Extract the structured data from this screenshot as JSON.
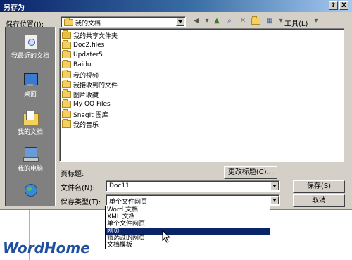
{
  "window": {
    "title": "另存为",
    "help_btn": "?",
    "close_btn": "X"
  },
  "save_in": {
    "label": "保存位置(I):",
    "value": "我的文档"
  },
  "toolbar": {
    "tools_label": "工具(L)"
  },
  "places": [
    {
      "label": "我最近的文档",
      "icon": "recent-docs-icon"
    },
    {
      "label": "桌面",
      "icon": "desktop-icon"
    },
    {
      "label": "我的文档",
      "icon": "my-documents-icon"
    },
    {
      "label": "我的电脑",
      "icon": "my-computer-icon"
    },
    {
      "label": "",
      "icon": "network-icon"
    }
  ],
  "files": [
    {
      "name": "我的共享文件夹",
      "icon": "shared-folder-icon"
    },
    {
      "name": "Doc2.files",
      "icon": "folder-icon"
    },
    {
      "name": "Updater5",
      "icon": "folder-icon"
    },
    {
      "name": "Baidu",
      "icon": "folder-icon"
    },
    {
      "name": "我的视频",
      "icon": "folder-icon"
    },
    {
      "name": "我接收到的文件",
      "icon": "folder-icon"
    },
    {
      "name": "图片收藏",
      "icon": "folder-icon"
    },
    {
      "name": "My QQ Files",
      "icon": "folder-icon"
    },
    {
      "name": "SnagIt 图库",
      "icon": "folder-icon"
    },
    {
      "name": "我的音乐",
      "icon": "folder-icon"
    }
  ],
  "page_title": {
    "label": "页标题:",
    "change_btn": "更改标题(C)..."
  },
  "filename": {
    "label": "文件名(N):",
    "value": "Doc11"
  },
  "filetype": {
    "label": "保存类型(T):",
    "value": "单个文件网页"
  },
  "buttons": {
    "save": "保存(S)",
    "cancel": "取消"
  },
  "type_options": [
    {
      "label": "Word 文档",
      "selected": false
    },
    {
      "label": "XML 文档",
      "selected": false
    },
    {
      "label": "单个文件网页",
      "selected": false
    },
    {
      "label": "网页",
      "selected": true
    },
    {
      "label": "筛选过的网页",
      "selected": false
    },
    {
      "label": "文档模板",
      "selected": false
    }
  ],
  "watermark": {
    "text": "WordHome"
  }
}
